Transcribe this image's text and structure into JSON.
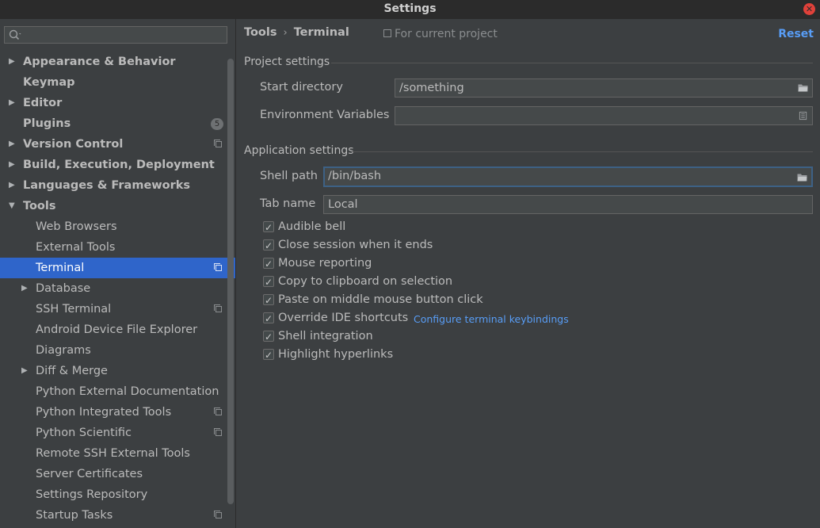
{
  "window": {
    "title": "Settings"
  },
  "search": {
    "value": "",
    "placeholder": ""
  },
  "sidebar": {
    "items": [
      {
        "label": "Appearance & Behavior",
        "level": 0,
        "bold": true,
        "arrow": "right"
      },
      {
        "label": "Keymap",
        "level": 0,
        "bold": true,
        "arrow": ""
      },
      {
        "label": "Editor",
        "level": 0,
        "bold": true,
        "arrow": "right"
      },
      {
        "label": "Plugins",
        "level": 0,
        "bold": true,
        "arrow": "",
        "badge": "5"
      },
      {
        "label": "Version Control",
        "level": 0,
        "bold": true,
        "arrow": "right",
        "project_icon": true
      },
      {
        "label": "Build, Execution, Deployment",
        "level": 0,
        "bold": true,
        "arrow": "right"
      },
      {
        "label": "Languages & Frameworks",
        "level": 0,
        "bold": true,
        "arrow": "right"
      },
      {
        "label": "Tools",
        "level": 0,
        "bold": true,
        "arrow": "down"
      },
      {
        "label": "Web Browsers",
        "level": 1,
        "bold": false,
        "arrow": ""
      },
      {
        "label": "External Tools",
        "level": 1,
        "bold": false,
        "arrow": ""
      },
      {
        "label": "Terminal",
        "level": 1,
        "bold": false,
        "arrow": "",
        "project_icon": true,
        "selected": true
      },
      {
        "label": "Database",
        "level": 1,
        "bold": false,
        "arrow": "right"
      },
      {
        "label": "SSH Terminal",
        "level": 1,
        "bold": false,
        "arrow": "",
        "project_icon": true
      },
      {
        "label": "Android Device File Explorer",
        "level": 1,
        "bold": false,
        "arrow": ""
      },
      {
        "label": "Diagrams",
        "level": 1,
        "bold": false,
        "arrow": ""
      },
      {
        "label": "Diff & Merge",
        "level": 1,
        "bold": false,
        "arrow": "right"
      },
      {
        "label": "Python External Documentation",
        "level": 1,
        "bold": false,
        "arrow": ""
      },
      {
        "label": "Python Integrated Tools",
        "level": 1,
        "bold": false,
        "arrow": "",
        "project_icon": true
      },
      {
        "label": "Python Scientific",
        "level": 1,
        "bold": false,
        "arrow": "",
        "project_icon": true
      },
      {
        "label": "Remote SSH External Tools",
        "level": 1,
        "bold": false,
        "arrow": ""
      },
      {
        "label": "Server Certificates",
        "level": 1,
        "bold": false,
        "arrow": ""
      },
      {
        "label": "Settings Repository",
        "level": 1,
        "bold": false,
        "arrow": ""
      },
      {
        "label": "Startup Tasks",
        "level": 1,
        "bold": false,
        "arrow": "",
        "project_icon": true
      }
    ]
  },
  "header": {
    "breadcrumb": [
      "Tools",
      "Terminal"
    ],
    "breadcrumb_sep": "›",
    "scope_label": "For current project",
    "reset_label": "Reset"
  },
  "project_settings": {
    "title": "Project settings",
    "start_directory": {
      "label": "Start directory",
      "value": "/something"
    },
    "env_vars": {
      "label": "Environment Variables",
      "value": ""
    }
  },
  "application_settings": {
    "title": "Application settings",
    "shell_path": {
      "label": "Shell path",
      "value": "/bin/bash"
    },
    "tab_name": {
      "label": "Tab name",
      "value": "Local"
    },
    "checkboxes": [
      {
        "label": "Audible bell",
        "checked": true
      },
      {
        "label": "Close session when it ends",
        "checked": true
      },
      {
        "label": "Mouse reporting",
        "checked": true
      },
      {
        "label": "Copy to clipboard on selection",
        "checked": true
      },
      {
        "label": "Paste on middle mouse button click",
        "checked": true
      },
      {
        "label": "Override IDE shortcuts",
        "checked": true
      },
      {
        "label": "Shell integration",
        "checked": true
      },
      {
        "label": "Highlight hyperlinks",
        "checked": true
      }
    ],
    "keybindings_link": "Configure terminal keybindings"
  },
  "colors": {
    "accent": "#589df6",
    "selection": "#2f65ca",
    "background": "#3c3f41",
    "close": "#e0413a"
  }
}
